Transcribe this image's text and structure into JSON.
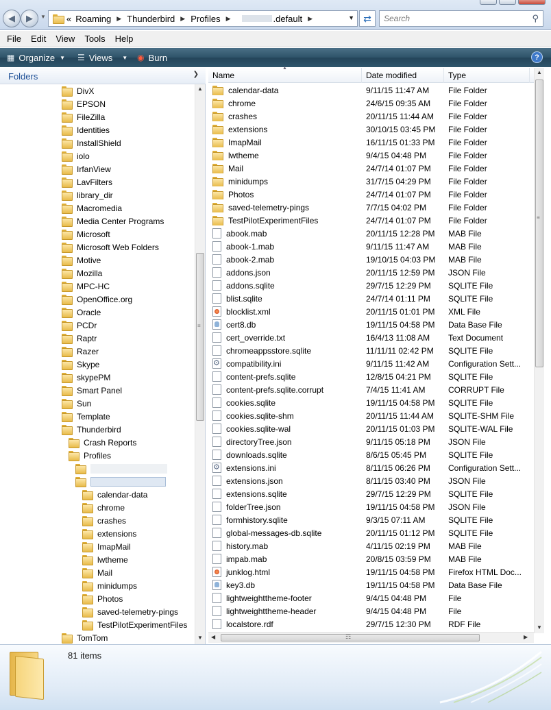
{
  "address": {
    "crumbs": [
      "Roaming",
      "Thunderbird",
      "Profiles",
      ".default"
    ],
    "overflow_glyph": "«",
    "search_placeholder": "Search"
  },
  "menu": [
    "File",
    "Edit",
    "View",
    "Tools",
    "Help"
  ],
  "command_bar": {
    "organize": "Organize",
    "views": "Views",
    "burn": "Burn",
    "help": "?"
  },
  "nav": {
    "header": "Folders",
    "tree": [
      {
        "label": "DivX",
        "level": 0
      },
      {
        "label": "EPSON",
        "level": 0
      },
      {
        "label": "FileZilla",
        "level": 0
      },
      {
        "label": "Identities",
        "level": 0
      },
      {
        "label": "InstallShield",
        "level": 0
      },
      {
        "label": "iolo",
        "level": 0
      },
      {
        "label": "IrfanView",
        "level": 0
      },
      {
        "label": "LavFilters",
        "level": 0
      },
      {
        "label": "library_dir",
        "level": 0
      },
      {
        "label": "Macromedia",
        "level": 0
      },
      {
        "label": "Media Center Programs",
        "level": 0
      },
      {
        "label": "Microsoft",
        "level": 0
      },
      {
        "label": "Microsoft Web Folders",
        "level": 0
      },
      {
        "label": "Motive",
        "level": 0
      },
      {
        "label": "Mozilla",
        "level": 0
      },
      {
        "label": "MPC-HC",
        "level": 0
      },
      {
        "label": "OpenOffice.org",
        "level": 0
      },
      {
        "label": "Oracle",
        "level": 0
      },
      {
        "label": "PCDr",
        "level": 0
      },
      {
        "label": "Raptr",
        "level": 0
      },
      {
        "label": "Razer",
        "level": 0
      },
      {
        "label": "Skype",
        "level": 0
      },
      {
        "label": "skypePM",
        "level": 0
      },
      {
        "label": "Smart Panel",
        "level": 0
      },
      {
        "label": "Sun",
        "level": 0
      },
      {
        "label": "Template",
        "level": 0
      },
      {
        "label": "Thunderbird",
        "level": 0
      },
      {
        "label": "Crash Reports",
        "level": 1
      },
      {
        "label": "Profiles",
        "level": 1
      },
      {
        "label": "",
        "level": 2
      },
      {
        "label": "",
        "level": 2,
        "selected": true
      },
      {
        "label": "calendar-data",
        "level": 3
      },
      {
        "label": "chrome",
        "level": 3
      },
      {
        "label": "crashes",
        "level": 3
      },
      {
        "label": "extensions",
        "level": 3
      },
      {
        "label": "ImapMail",
        "level": 3
      },
      {
        "label": "lwtheme",
        "level": 3
      },
      {
        "label": "Mail",
        "level": 3
      },
      {
        "label": "minidumps",
        "level": 3
      },
      {
        "label": "Photos",
        "level": 3
      },
      {
        "label": "saved-telemetry-pings",
        "level": 3
      },
      {
        "label": "TestPilotExperimentFiles",
        "level": 3
      },
      {
        "label": "TomTom",
        "level": 0
      }
    ]
  },
  "columns": {
    "name": "Name",
    "date": "Date modified",
    "type": "Type"
  },
  "files": [
    {
      "name": "calendar-data",
      "date": "9/11/15 11:47 AM",
      "type": "File Folder",
      "icon": "folder"
    },
    {
      "name": "chrome",
      "date": "24/6/15 09:35 AM",
      "type": "File Folder",
      "icon": "folder"
    },
    {
      "name": "crashes",
      "date": "20/11/15 11:44 AM",
      "type": "File Folder",
      "icon": "folder"
    },
    {
      "name": "extensions",
      "date": "30/10/15 03:45 PM",
      "type": "File Folder",
      "icon": "folder"
    },
    {
      "name": "ImapMail",
      "date": "16/11/15 01:33 PM",
      "type": "File Folder",
      "icon": "folder"
    },
    {
      "name": "lwtheme",
      "date": "9/4/15 04:48 PM",
      "type": "File Folder",
      "icon": "folder"
    },
    {
      "name": "Mail",
      "date": "24/7/14 01:07 PM",
      "type": "File Folder",
      "icon": "folder"
    },
    {
      "name": "minidumps",
      "date": "31/7/15 04:29 PM",
      "type": "File Folder",
      "icon": "folder"
    },
    {
      "name": "Photos",
      "date": "24/7/14 01:07 PM",
      "type": "File Folder",
      "icon": "folder"
    },
    {
      "name": "saved-telemetry-pings",
      "date": "7/7/15 04:02 PM",
      "type": "File Folder",
      "icon": "folder"
    },
    {
      "name": "TestPilotExperimentFiles",
      "date": "24/7/14 01:07 PM",
      "type": "File Folder",
      "icon": "folder"
    },
    {
      "name": "abook.mab",
      "date": "20/11/15 12:28 PM",
      "type": "MAB File",
      "icon": "file"
    },
    {
      "name": "abook-1.mab",
      "date": "9/11/15 11:47 AM",
      "type": "MAB File",
      "icon": "file"
    },
    {
      "name": "abook-2.mab",
      "date": "19/10/15 04:03 PM",
      "type": "MAB File",
      "icon": "file"
    },
    {
      "name": "addons.json",
      "date": "20/11/15 12:59 PM",
      "type": "JSON File",
      "icon": "file"
    },
    {
      "name": "addons.sqlite",
      "date": "29/7/15 12:29 PM",
      "type": "SQLITE File",
      "icon": "file"
    },
    {
      "name": "blist.sqlite",
      "date": "24/7/14 01:11 PM",
      "type": "SQLITE File",
      "icon": "file"
    },
    {
      "name": "blocklist.xml",
      "date": "20/11/15 01:01 PM",
      "type": "XML File",
      "icon": "xml"
    },
    {
      "name": "cert8.db",
      "date": "19/11/15 04:58 PM",
      "type": "Data Base File",
      "icon": "db"
    },
    {
      "name": "cert_override.txt",
      "date": "16/4/13 11:08 AM",
      "type": "Text Document",
      "icon": "file"
    },
    {
      "name": "chromeappsstore.sqlite",
      "date": "11/11/11 02:42 PM",
      "type": "SQLITE File",
      "icon": "file"
    },
    {
      "name": "compatibility.ini",
      "date": "9/11/15 11:42 AM",
      "type": "Configuration Sett...",
      "icon": "ini"
    },
    {
      "name": "content-prefs.sqlite",
      "date": "12/8/15 04:21 PM",
      "type": "SQLITE File",
      "icon": "file"
    },
    {
      "name": "content-prefs.sqlite.corrupt",
      "date": "7/4/15 11:41 AM",
      "type": "CORRUPT File",
      "icon": "file"
    },
    {
      "name": "cookies.sqlite",
      "date": "19/11/15 04:58 PM",
      "type": "SQLITE File",
      "icon": "file"
    },
    {
      "name": "cookies.sqlite-shm",
      "date": "20/11/15 11:44 AM",
      "type": "SQLITE-SHM File",
      "icon": "file"
    },
    {
      "name": "cookies.sqlite-wal",
      "date": "20/11/15 01:03 PM",
      "type": "SQLITE-WAL File",
      "icon": "file"
    },
    {
      "name": "directoryTree.json",
      "date": "9/11/15 05:18 PM",
      "type": "JSON File",
      "icon": "file"
    },
    {
      "name": "downloads.sqlite",
      "date": "8/6/15 05:45 PM",
      "type": "SQLITE File",
      "icon": "file"
    },
    {
      "name": "extensions.ini",
      "date": "8/11/15 06:26 PM",
      "type": "Configuration Sett...",
      "icon": "ini"
    },
    {
      "name": "extensions.json",
      "date": "8/11/15 03:40 PM",
      "type": "JSON File",
      "icon": "file"
    },
    {
      "name": "extensions.sqlite",
      "date": "29/7/15 12:29 PM",
      "type": "SQLITE File",
      "icon": "file"
    },
    {
      "name": "folderTree.json",
      "date": "19/11/15 04:58 PM",
      "type": "JSON File",
      "icon": "file"
    },
    {
      "name": "formhistory.sqlite",
      "date": "9/3/15 07:11 AM",
      "type": "SQLITE File",
      "icon": "file"
    },
    {
      "name": "global-messages-db.sqlite",
      "date": "20/11/15 01:12 PM",
      "type": "SQLITE File",
      "icon": "file"
    },
    {
      "name": "history.mab",
      "date": "4/11/15 02:19 PM",
      "type": "MAB File",
      "icon": "file"
    },
    {
      "name": "impab.mab",
      "date": "20/8/15 03:59 PM",
      "type": "MAB File",
      "icon": "file"
    },
    {
      "name": "junklog.html",
      "date": "19/11/15 04:58 PM",
      "type": "Firefox HTML Doc...",
      "icon": "html"
    },
    {
      "name": "key3.db",
      "date": "19/11/15 04:58 PM",
      "type": "Data Base File",
      "icon": "db"
    },
    {
      "name": "lightweighttheme-footer",
      "date": "9/4/15 04:48 PM",
      "type": "File",
      "icon": "file"
    },
    {
      "name": "lightweighttheme-header",
      "date": "9/4/15 04:48 PM",
      "type": "File",
      "icon": "file"
    },
    {
      "name": "localstore.rdf",
      "date": "29/7/15 12:30 PM",
      "type": "RDF File",
      "icon": "file"
    }
  ],
  "details": {
    "item_count": "81 items"
  }
}
